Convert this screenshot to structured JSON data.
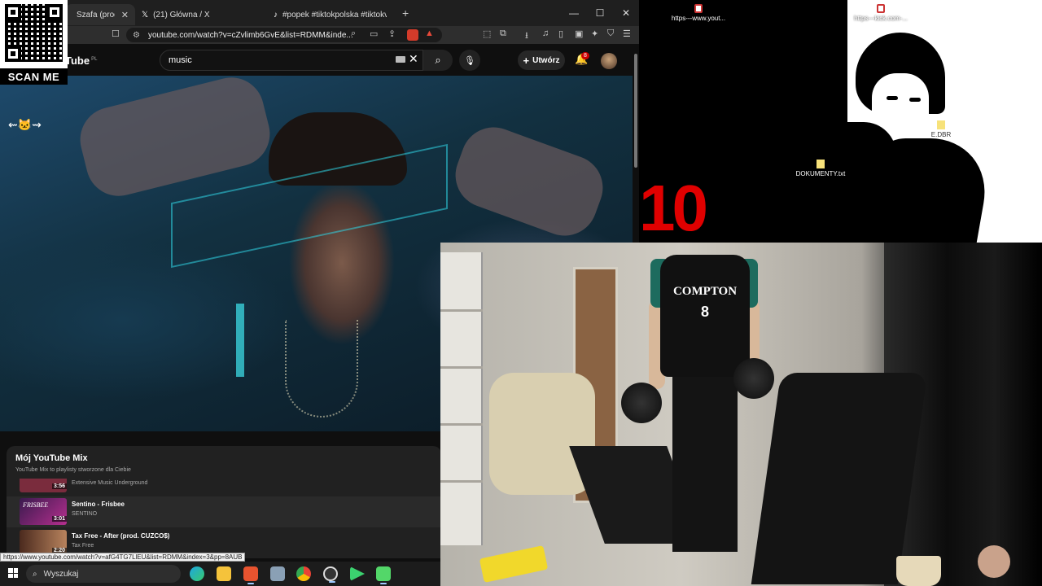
{
  "browser": {
    "tabs": [
      {
        "label": "Szafa (prod. VB)",
        "icon": "youtube-icon",
        "active": true
      },
      {
        "label": "(21) Główna / X",
        "icon": "x-logo-icon",
        "active": false
      },
      {
        "label": "#popek #tiktokpolska #tiktokviral #g",
        "icon": "tiktok-icon",
        "active": false
      }
    ],
    "new_tab": "+",
    "window_controls": {
      "minimize": "—",
      "maximize": "☐",
      "close": "✕"
    },
    "address": "youtube.com/watch?v=cZvlimb6GvE&list=RDMM&inde...",
    "extension_badge_color": "#d43b2a"
  },
  "youtube": {
    "logo_text": "Tube",
    "region": "PL",
    "search_value": "music",
    "create_label": "Utwórz",
    "notifications": "8",
    "accent": "#cc0000"
  },
  "qr": {
    "label": "SCAN ME"
  },
  "playlist": {
    "title": "Mój YouTube Mix",
    "subtitle": "YouTube Mix to playlisty stworzone dla Ciebie",
    "items": [
      {
        "duration": "3:56",
        "title": "",
        "artist": "Extensive Music Underground",
        "thumb_color": "#7a2c3d"
      },
      {
        "duration": "3:01",
        "title": "Sentino - Frisbee",
        "artist": "SENTINO",
        "thumb_color": "#6d2a77",
        "thumb_text": "FRISBEE"
      },
      {
        "duration": "2:20",
        "title": "Tax Free - After (prod. CUZCO$)",
        "artist": "Tax Free",
        "thumb_color": "#8a5d44"
      }
    ]
  },
  "status_url": "https://www.youtube.com/watch?v=afG4TG7LlEU&list=RDMM&index=3&pp=8AUB",
  "desktop": {
    "icons": [
      {
        "label": "https---www.yout...",
        "type": "shortcut"
      },
      {
        "label": "https---kick.com-...",
        "type": "shortcut"
      },
      {
        "label": "DOKUMENTY.txt",
        "type": "file"
      },
      {
        "label": "E.DBR",
        "type": "file"
      }
    ],
    "countdown": "10",
    "countdown_color": "#e00000"
  },
  "webcam": {
    "jersey_text": "COMPTON",
    "jersey_number": "8"
  },
  "taskbar": {
    "search_placeholder": "Wyszukaj",
    "apps": [
      "edge-icon",
      "file-explorer-icon",
      "brave-icon",
      "app-icon",
      "chrome-icon",
      "obs-icon",
      "terminal-icon",
      "chat-icon"
    ]
  }
}
